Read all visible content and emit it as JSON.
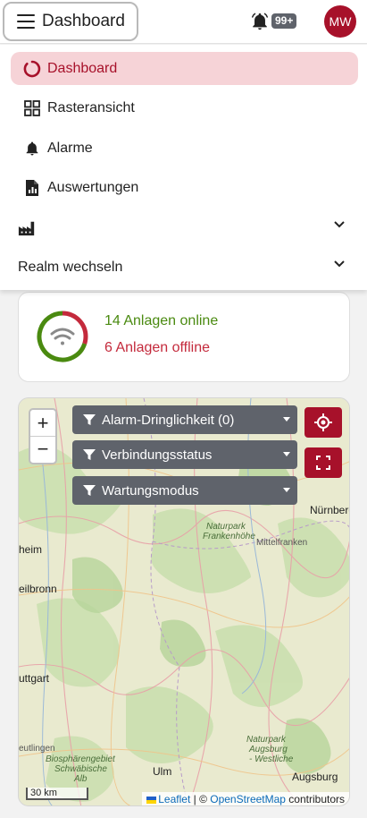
{
  "header": {
    "title": "Dashboard",
    "notification_count": "99+",
    "avatar_initials": "MW"
  },
  "nav": {
    "items": [
      {
        "label": "Dashboard",
        "icon": "loading-ring-icon",
        "active": true
      },
      {
        "label": "Rasteransicht",
        "icon": "grid-icon"
      },
      {
        "label": "Alarme",
        "icon": "bell-icon"
      },
      {
        "label": "Auswertungen",
        "icon": "report-icon"
      },
      {
        "label": "",
        "icon": "factory-icon"
      },
      {
        "label": "Realm wechseln",
        "icon": ""
      }
    ]
  },
  "status": {
    "online_text": "14 Anlagen online",
    "offline_text": "6 Anlagen offline",
    "online_count": 14,
    "offline_count": 6,
    "colors": {
      "online": "#4a8a10",
      "offline": "#c42a3c",
      "accent": "#a7112a"
    }
  },
  "map": {
    "zoom_in": "+",
    "zoom_out": "−",
    "filters": [
      {
        "label": "Alarm-Dringlichkeit (0)"
      },
      {
        "label": "Verbindungsstatus"
      },
      {
        "label": "Wartungsmodus"
      }
    ],
    "scale": "30 km",
    "attribution": {
      "leaflet": "Leaflet",
      "separator": " | © ",
      "osm": "OpenStreetMap",
      "suffix": " contributors"
    },
    "labels": {
      "nuernberg": "Nürnberg",
      "frankenhoehe_1": "Naturpark",
      "frankenhoehe_2": "Frankenhöhe",
      "mittelfranken": "Mittelfranken",
      "heim": "heim",
      "heilbronn": "eilbronn",
      "stuttgart": "uttgart",
      "reutlingen": "eutlingen",
      "bio_1": "Biosphärengebiet",
      "bio_2": "Schwäbische",
      "bio_3": "Alb",
      "ulm": "Ulm",
      "augsburg_park_1": "Naturpark",
      "augsburg_park_2": "Augsburg",
      "augsburg_park_3": "- Westliche",
      "augsburg": "Augsburg"
    }
  }
}
